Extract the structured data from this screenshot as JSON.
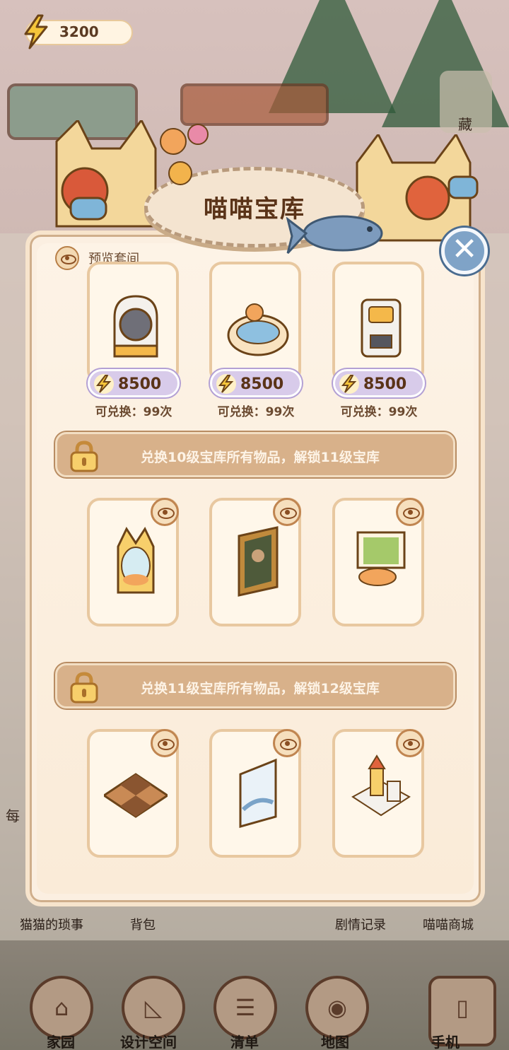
{
  "energy": {
    "value": "3200"
  },
  "background": {
    "corner_label": "藏",
    "side_text": "每"
  },
  "modal": {
    "title": "喵喵宝库",
    "close_icon": "close-icon",
    "preview_label": "预览套间",
    "top_items": [
      {
        "name": "cat-litter-box",
        "price": "8500",
        "remaining": "可兑换：99次"
      },
      {
        "name": "cat-bed",
        "price": "8500",
        "remaining": "可兑换：99次"
      },
      {
        "name": "cat-feeder",
        "price": "8500",
        "remaining": "可兑换：99次"
      }
    ],
    "unlock_tiers": [
      {
        "text": "兑换10级宝库所有物品，解锁11级宝库",
        "items": [
          "cat-window-pod",
          "painting-frame",
          "window-bed"
        ]
      },
      {
        "text": "兑换11级宝库所有物品，解锁12级宝库",
        "items": [
          "checker-rug",
          "wall-poster",
          "castle-model"
        ]
      }
    ]
  },
  "quick_links": [
    "猫猫的琐事",
    "背包",
    "剧情记录",
    "喵喵商城"
  ],
  "bottom_nav": [
    "家园",
    "设计空间",
    "清单",
    "地图",
    "手机"
  ],
  "colors": {
    "accent": "#d8b18a",
    "title_text": "#5a3318",
    "price_bg": "#d8cbea",
    "close_bg": "#7fa3c7"
  }
}
